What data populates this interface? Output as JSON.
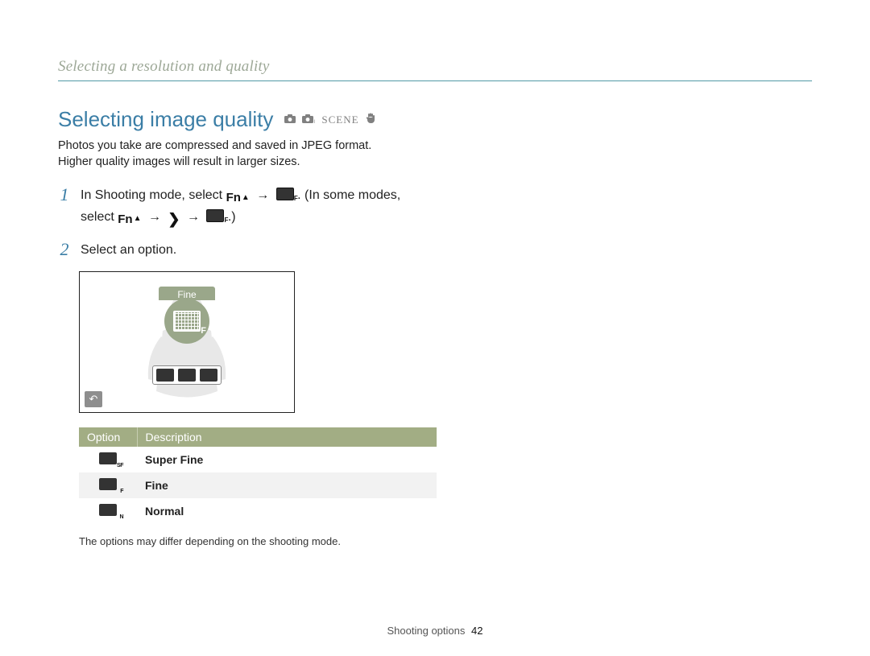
{
  "breadcrumb": "Selecting a resolution and quality",
  "heading": "Selecting image quality",
  "mode_icons": [
    "camera",
    "camera-p",
    "SCENE",
    "hand"
  ],
  "intro_lines": [
    "Photos you take are compressed and saved in JPEG format.",
    "Higher quality images will result in larger sizes."
  ],
  "steps": {
    "s1": {
      "num": "1",
      "part1": "In Shooting mode, select ",
      "fn_label_1": "Fn",
      "arrow1": " → ",
      "part2": ". (In some modes,",
      "part3": "select ",
      "fn_label_2": "Fn",
      "arrow2": " → ",
      "arrow3": " → ",
      "close": ".)"
    },
    "s2": {
      "num": "2",
      "text": "Select an option."
    }
  },
  "mock": {
    "selected_label": "Fine",
    "back_glyph": "↶",
    "options_count": 3
  },
  "table": {
    "headers": {
      "option": "Option",
      "description": "Description"
    },
    "rows": [
      {
        "icon": "sf",
        "label": "Super Fine"
      },
      {
        "icon": "f",
        "label": "Fine"
      },
      {
        "icon": "n",
        "label": "Normal"
      }
    ]
  },
  "note": "The options may differ depending on the shooting mode.",
  "footer": {
    "section": "Shooting options",
    "page": "42"
  }
}
